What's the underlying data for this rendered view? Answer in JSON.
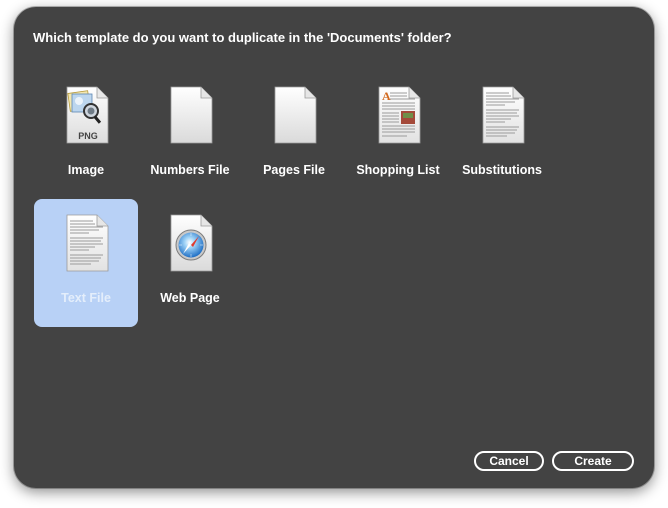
{
  "dialog": {
    "prompt": "Which template do you want to duplicate in the 'Documents' folder?",
    "templates": [
      {
        "label": "Image",
        "icon": "png-image-icon",
        "badge": "PNG"
      },
      {
        "label": "Numbers File",
        "icon": "blank-document-icon"
      },
      {
        "label": "Pages File",
        "icon": "blank-document-icon"
      },
      {
        "label": "Shopping List",
        "icon": "illustrated-document-icon"
      },
      {
        "label": "Substitutions",
        "icon": "text-document-icon"
      },
      {
        "label": "Text File",
        "icon": "text-document-icon",
        "selected": true
      },
      {
        "label": "Web Page",
        "icon": "safari-compass-icon"
      }
    ],
    "buttons": {
      "cancel": "Cancel",
      "create": "Create"
    }
  },
  "colors": {
    "background": "#434343",
    "selection": "#b8d1f6",
    "text": "#ffffff"
  }
}
